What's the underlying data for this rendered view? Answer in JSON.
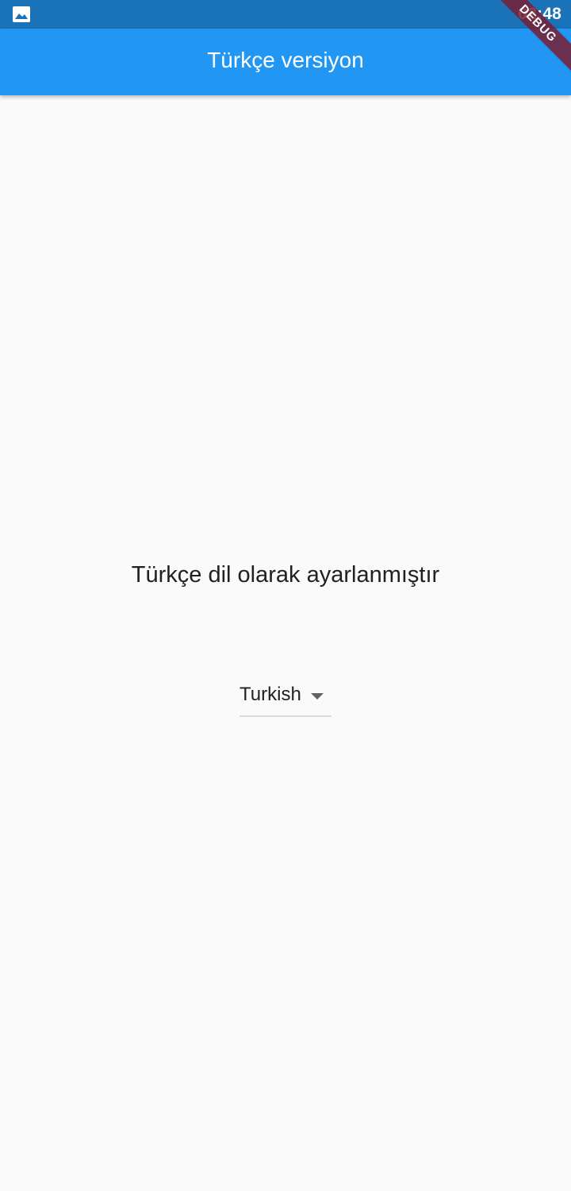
{
  "status_bar": {
    "time": "02:48",
    "left_icon": "image-icon",
    "background": "#1a73b9"
  },
  "app_bar": {
    "title": "Türkçe versiyon",
    "background": "#2196f3"
  },
  "debug_banner": {
    "label": "DEBUG"
  },
  "main": {
    "message": "Türkçe dil olarak ayarlanmıştır",
    "language_dropdown": {
      "selected": "Turkish",
      "icon": "arrow-drop-down-icon"
    }
  }
}
